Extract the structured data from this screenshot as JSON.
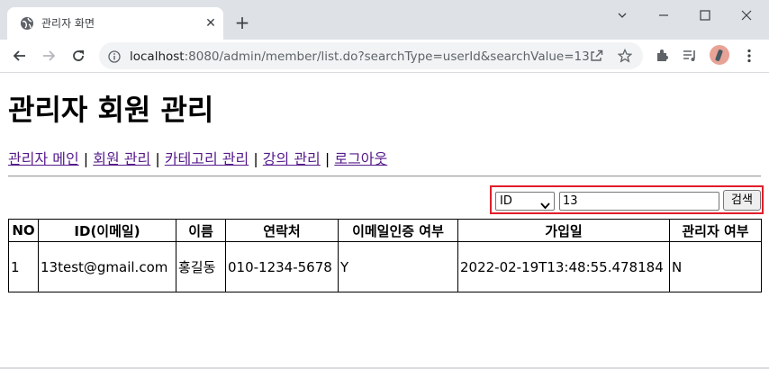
{
  "browser": {
    "tab_title": "관리자 화면",
    "url_host": "localhost",
    "url_path": ":8080/admin/member/list.do?searchType=userId&searchValue=13"
  },
  "page": {
    "title": "관리자 회원 관리",
    "menu": [
      "관리자 메인",
      "회원 관리",
      "카테고리 관리",
      "강의 관리",
      "로그아웃"
    ],
    "menu_separator": "|"
  },
  "search": {
    "type_selected": "ID",
    "value": "13",
    "button_label": "검색"
  },
  "table": {
    "headers": [
      "NO",
      "ID(이메일)",
      "이름",
      "연락처",
      "이메일인증 여부",
      "가입일",
      "관리자 여부"
    ],
    "rows": [
      [
        "1",
        "13test@gmail.com",
        "홍길동",
        "010-1234-5678",
        "Y",
        "2022-02-19T13:48:55.478184",
        "N"
      ]
    ]
  },
  "colors": {
    "highlight_border": "#e11d2a",
    "visited_link": "#551a8b",
    "tabbar_bg": "#dee1e6"
  }
}
